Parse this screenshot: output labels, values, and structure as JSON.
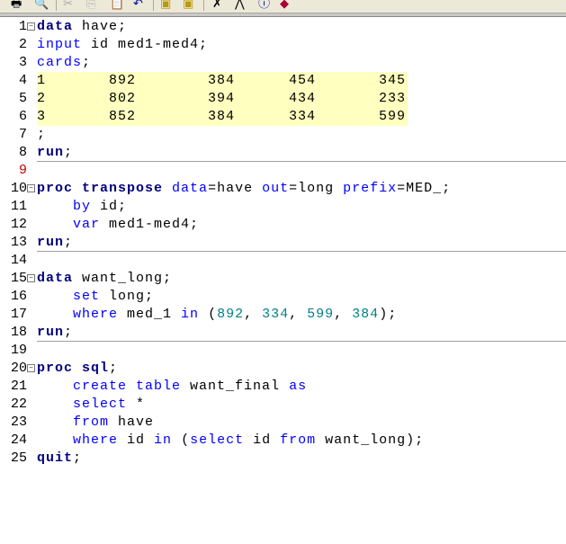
{
  "toolbar": {
    "icons": [
      "print-icon",
      "print-preview-icon",
      "cut-icon",
      "copy-icon",
      "paste-icon",
      "undo-icon",
      "new-library-icon",
      "explorer-icon",
      "run-icon",
      "cancel-icon",
      "help-icon",
      "book-icon"
    ]
  },
  "colors": {
    "keyword": "#000080",
    "statement": "#0000ff",
    "number": "#008080",
    "highlight": "#ffffc0"
  },
  "lines": [
    {
      "n": "1",
      "fold": true,
      "t": [
        [
          "kw",
          "data"
        ],
        [
          "tx",
          " have;"
        ]
      ]
    },
    {
      "n": "2",
      "t": [
        [
          "st",
          "input"
        ],
        [
          "tx",
          " id med1-med4;"
        ]
      ]
    },
    {
      "n": "3",
      "t": [
        [
          "st",
          "cards"
        ],
        [
          "tx",
          ";"
        ]
      ]
    },
    {
      "n": "4",
      "hl": true,
      "t": [
        [
          "tx",
          "1       892        384      454       345"
        ]
      ]
    },
    {
      "n": "5",
      "hl": true,
      "t": [
        [
          "tx",
          "2       802        394      434       233"
        ]
      ]
    },
    {
      "n": "6",
      "hl": true,
      "t": [
        [
          "tx",
          "3       852        384      334       599"
        ]
      ]
    },
    {
      "n": "7",
      "t": [
        [
          "tx",
          ";"
        ]
      ]
    },
    {
      "n": "8",
      "sep": true,
      "t": [
        [
          "kw",
          "run"
        ],
        [
          "tx",
          ";"
        ]
      ]
    },
    {
      "n": "9",
      "red": true,
      "t": []
    },
    {
      "n": "10",
      "fold": true,
      "t": [
        [
          "kw",
          "proc transpose"
        ],
        [
          "tx",
          " "
        ],
        [
          "st",
          "data"
        ],
        [
          "tx",
          "=have "
        ],
        [
          "st",
          "out"
        ],
        [
          "tx",
          "=long "
        ],
        [
          "st",
          "prefix"
        ],
        [
          "tx",
          "=MED_;"
        ]
      ]
    },
    {
      "n": "11",
      "t": [
        [
          "tx",
          "    "
        ],
        [
          "st",
          "by"
        ],
        [
          "tx",
          " id;"
        ]
      ]
    },
    {
      "n": "12",
      "t": [
        [
          "tx",
          "    "
        ],
        [
          "st",
          "var"
        ],
        [
          "tx",
          " med1-med4;"
        ]
      ]
    },
    {
      "n": "13",
      "sep": true,
      "t": [
        [
          "kw",
          "run"
        ],
        [
          "tx",
          ";"
        ]
      ]
    },
    {
      "n": "14",
      "t": []
    },
    {
      "n": "15",
      "fold": true,
      "t": [
        [
          "kw",
          "data"
        ],
        [
          "tx",
          " want_long;"
        ]
      ]
    },
    {
      "n": "16",
      "t": [
        [
          "tx",
          "    "
        ],
        [
          "st",
          "set"
        ],
        [
          "tx",
          " long;"
        ]
      ]
    },
    {
      "n": "17",
      "t": [
        [
          "tx",
          "    "
        ],
        [
          "st",
          "where"
        ],
        [
          "tx",
          " med_1 "
        ],
        [
          "st",
          "in"
        ],
        [
          "tx",
          " ("
        ],
        [
          "num",
          "892"
        ],
        [
          "tx",
          ", "
        ],
        [
          "num",
          "334"
        ],
        [
          "tx",
          ", "
        ],
        [
          "num",
          "599"
        ],
        [
          "tx",
          ", "
        ],
        [
          "num",
          "384"
        ],
        [
          "tx",
          ");"
        ]
      ]
    },
    {
      "n": "18",
      "sep": true,
      "t": [
        [
          "kw",
          "run"
        ],
        [
          "tx",
          ";"
        ]
      ]
    },
    {
      "n": "19",
      "t": []
    },
    {
      "n": "20",
      "fold": true,
      "t": [
        [
          "kw",
          "proc sql"
        ],
        [
          "tx",
          ";"
        ]
      ]
    },
    {
      "n": "21",
      "t": [
        [
          "tx",
          "    "
        ],
        [
          "st",
          "create table"
        ],
        [
          "tx",
          " want_final "
        ],
        [
          "st",
          "as"
        ]
      ]
    },
    {
      "n": "22",
      "t": [
        [
          "tx",
          "    "
        ],
        [
          "st",
          "select"
        ],
        [
          "tx",
          " *"
        ]
      ]
    },
    {
      "n": "23",
      "t": [
        [
          "tx",
          "    "
        ],
        [
          "st",
          "from"
        ],
        [
          "tx",
          " have"
        ]
      ]
    },
    {
      "n": "24",
      "t": [
        [
          "tx",
          "    "
        ],
        [
          "st",
          "where"
        ],
        [
          "tx",
          " id "
        ],
        [
          "st",
          "in"
        ],
        [
          "tx",
          " ("
        ],
        [
          "st",
          "select"
        ],
        [
          "tx",
          " id "
        ],
        [
          "st",
          "from"
        ],
        [
          "tx",
          " want_long);"
        ]
      ]
    },
    {
      "n": "25",
      "t": [
        [
          "kw",
          "quit"
        ],
        [
          "tx",
          ";"
        ]
      ]
    }
  ]
}
